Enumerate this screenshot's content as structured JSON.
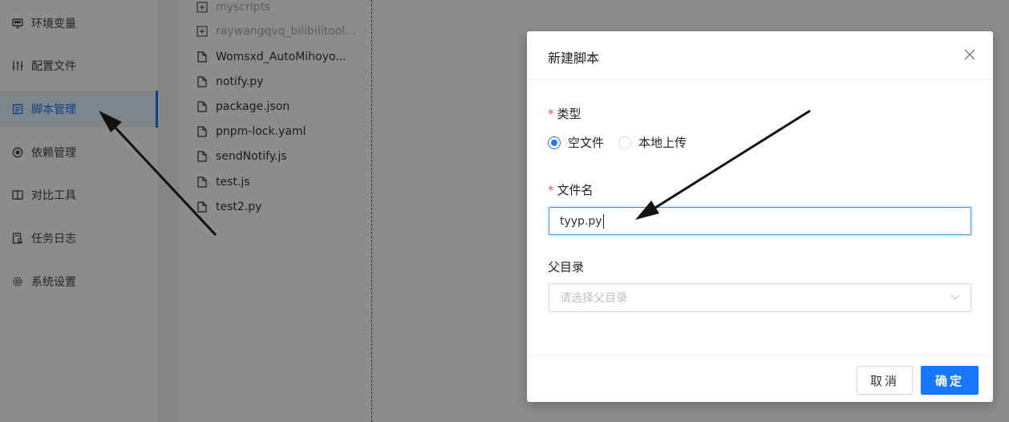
{
  "sidebar": {
    "items": [
      {
        "label": "环境变量",
        "icon": "desktop-icon"
      },
      {
        "label": "配置文件",
        "icon": "sliders-icon"
      },
      {
        "label": "脚本管理",
        "icon": "form-icon",
        "active": true
      },
      {
        "label": "依赖管理",
        "icon": "appstore-icon"
      },
      {
        "label": "对比工具",
        "icon": "diff-icon"
      },
      {
        "label": "任务日志",
        "icon": "file-search-icon"
      },
      {
        "label": "系统设置",
        "icon": "gear-icon"
      }
    ]
  },
  "file_tree": {
    "items": [
      {
        "label": "myscripts",
        "type": "folder"
      },
      {
        "label": "raywangqvq_bilibilitool...",
        "type": "folder"
      },
      {
        "label": "Womsxd_AutoMihoyo...",
        "type": "file"
      },
      {
        "label": "notify.py",
        "type": "file"
      },
      {
        "label": "package.json",
        "type": "file"
      },
      {
        "label": "pnpm-lock.yaml",
        "type": "file"
      },
      {
        "label": "sendNotify.js",
        "type": "file"
      },
      {
        "label": "test.js",
        "type": "file"
      },
      {
        "label": "test2.py",
        "type": "file"
      }
    ]
  },
  "modal": {
    "title": "新建脚本",
    "type_label": "类型",
    "type_options": [
      "空文件",
      "本地上传"
    ],
    "type_selected": "空文件",
    "filename_label": "文件名",
    "filename_value": "tyyp.py",
    "parent_label": "父目录",
    "parent_placeholder": "请选择父目录",
    "cancel_label": "取消",
    "ok_label": "确定"
  },
  "colors": {
    "accent": "#1677ff",
    "required": "#ff4d4f",
    "annotation_arrow": "#111111"
  }
}
